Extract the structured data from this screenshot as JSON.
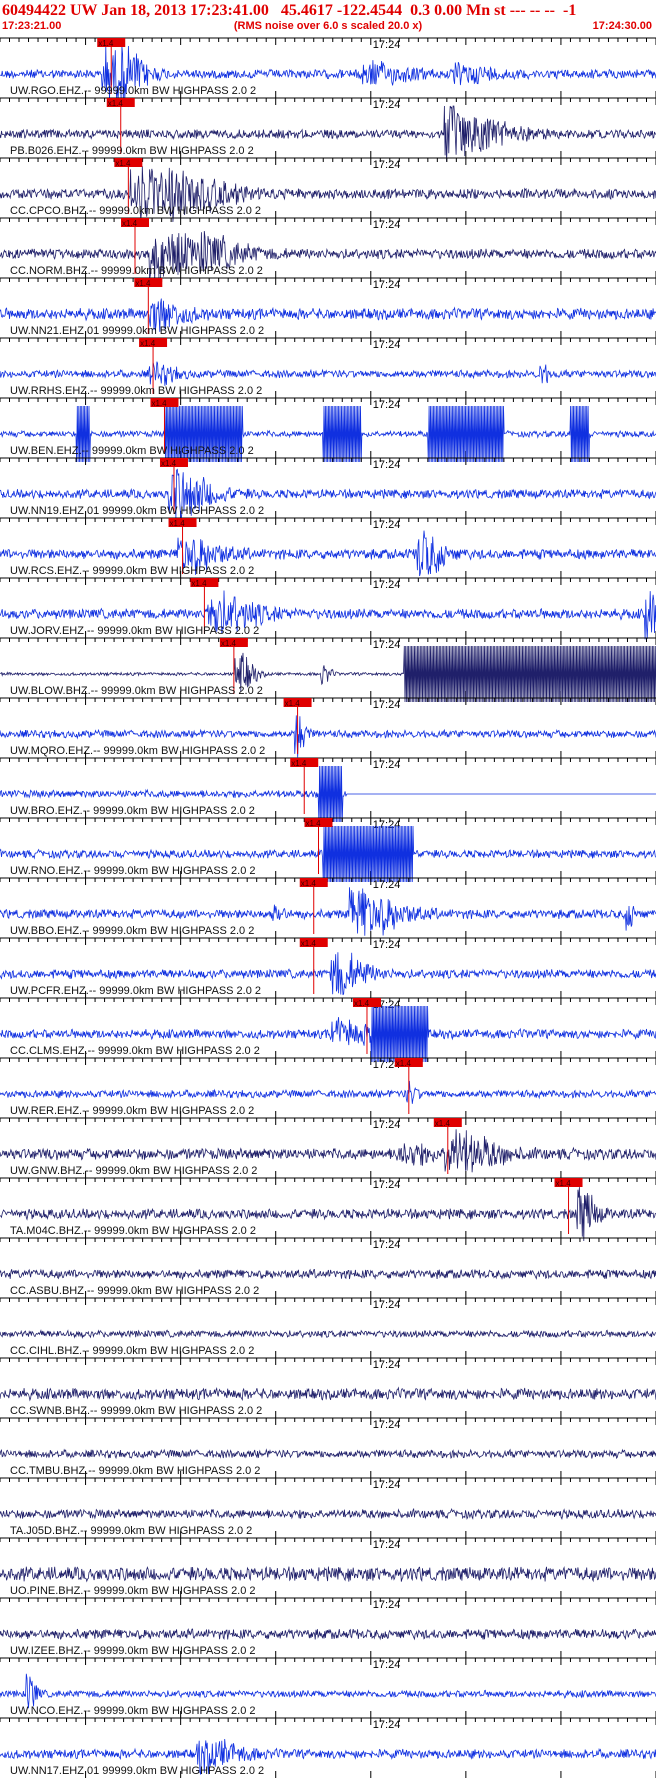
{
  "header": {
    "title": "60494422 UW Jan 18, 2013 17:23:41.00   45.4617 -122.4544  0.3 0.00 Mn st --- -- --  -1",
    "start_time": "17:23:21.00",
    "subtitle": "(RMS noise over 6.0 s scaled 20.0 x)",
    "end_time": "17:24:30.00"
  },
  "colors": {
    "title": "#e00000",
    "trace_blue": "#1030e0",
    "trace_navy": "#20206a",
    "pick_marker": "#e00000",
    "axis": "#000000"
  },
  "chart_data": {
    "type": "line",
    "description_of_axis": "",
    "x_start": "17:23:21.00",
    "x_end": "17:24:30.00",
    "minute_label": "17:24",
    "pick_label": "x1.4",
    "channels": [
      {
        "label": "UW.RGO.EHZ.-- 99999.0km BW  HIGHPASS  2.0  2",
        "color": "blue",
        "pick_s": 11.7,
        "amp": 0.18,
        "events": [
          [
            11,
            1.0,
            4
          ],
          [
            13,
            0.5,
            3
          ],
          [
            38,
            0.4,
            6
          ],
          [
            48,
            0.3,
            5
          ]
        ]
      },
      {
        "label": "PB.B026.EHZ.-- 99999.0km BW  HIGHPASS  2.0  2",
        "color": "navy",
        "pick_s": 12.7,
        "amp": 0.18,
        "events": [
          [
            47,
            1.0,
            7
          ]
        ]
      },
      {
        "label": "CC.CPCO.BHZ.-- 99999.0km BW  HIGHPASS  2.0  2",
        "color": "navy",
        "pick_s": 13.5,
        "amp": 0.2,
        "events": [
          [
            14,
            1.0,
            6
          ],
          [
            18,
            0.6,
            8
          ]
        ]
      },
      {
        "label": "CC.NORM.BHZ.-- 99999.0km BW  HIGHPASS  2.0  2",
        "color": "navy",
        "pick_s": 14.2,
        "amp": 0.2,
        "events": [
          [
            16,
            1.0,
            6
          ],
          [
            21,
            0.5,
            6
          ]
        ]
      },
      {
        "label": "UW.NN21.EHZ.01 99999.0km BW  HIGHPASS  2.0  2",
        "color": "blue",
        "pick_s": 15.6,
        "amp": 0.22,
        "events": [
          [
            16,
            0.6,
            4
          ]
        ]
      },
      {
        "label": "UW.RRHS.EHZ.-- 99999.0km BW  HIGHPASS  2.0  2",
        "color": "blue",
        "pick_s": 16.1,
        "amp": 0.15,
        "events": [
          [
            16,
            0.4,
            3
          ],
          [
            57,
            0.4,
            1
          ]
        ]
      },
      {
        "label": "UW.BEN.EHZ.-- 99999.0km BW  HIGHPASS  2.0  2",
        "color": "blue",
        "pick_s": 17.3,
        "amp": 0.12,
        "clip": [
          [
            8,
            9.5
          ],
          [
            17.3,
            25.5
          ],
          [
            34,
            38
          ],
          [
            45,
            53
          ],
          [
            60,
            62
          ]
        ]
      },
      {
        "label": "UW.NN19.EHZ.01 99999.0km BW  HIGHPASS  2.0  2",
        "color": "blue",
        "pick_s": 18.3,
        "amp": 0.18,
        "events": [
          [
            18,
            1.0,
            5
          ]
        ]
      },
      {
        "label": "UW.RCS.EHZ.-- 99999.0km BW  HIGHPASS  2.0  2",
        "color": "blue",
        "pick_s": 19.2,
        "amp": 0.2,
        "events": [
          [
            19,
            0.7,
            5
          ],
          [
            44,
            1.0,
            3
          ]
        ]
      },
      {
        "label": "UW.JORV.EHZ.-- 99999.0km BW  HIGHPASS  2.0  2",
        "color": "blue",
        "pick_s": 21.5,
        "amp": 0.2,
        "events": [
          [
            22,
            0.8,
            6
          ],
          [
            68,
            1.0,
            2
          ]
        ]
      },
      {
        "label": "UW.BLOW.BHZ.-- 99999.0km BW  HIGHPASS  2.0  2",
        "color": "navy",
        "pick_s": 24.6,
        "amp": 0.06,
        "events": [
          [
            25,
            0.9,
            2
          ],
          [
            34,
            0.4,
            1
          ]
        ],
        "clip": [
          [
            42.5,
            69
          ]
        ]
      },
      {
        "label": "UW.MQRO.EHZ.-- 99999.0km BW  HIGHPASS  2.0  2",
        "color": "blue",
        "pick_s": 31.3,
        "amp": 0.15,
        "events": [
          [
            31.3,
            1.0,
            1
          ]
        ]
      },
      {
        "label": "UW.BRO.EHZ.-- 99999.0km BW  HIGHPASS  2.0  2",
        "color": "blue",
        "pick_s": 32.0,
        "amp": 0.15,
        "clip": [
          [
            33.5,
            36
          ]
        ],
        "flat": [
          [
            36.5,
            69
          ]
        ],
        "events": [
          [
            52,
            0.8,
            1
          ]
        ]
      },
      {
        "label": "UW.RNO.EHZ.-- 99999.0km BW  HIGHPASS  2.0  2",
        "color": "blue",
        "pick_s": 33.5,
        "amp": 0.16,
        "clip": [
          [
            34,
            43.5
          ]
        ]
      },
      {
        "label": "UW.BBO.EHZ.-- 99999.0km BW  HIGHPASS  2.0  2",
        "color": "blue",
        "pick_s": 33.0,
        "amp": 0.18,
        "events": [
          [
            37,
            1.0,
            6
          ],
          [
            29,
            0.4,
            1
          ],
          [
            66,
            0.5,
            1
          ]
        ]
      },
      {
        "label": "UW.PCFR.EHZ.-- 99999.0km BW  HIGHPASS  2.0  2",
        "color": "blue",
        "pick_s": 33.0,
        "amp": 0.18,
        "events": [
          [
            35,
            0.9,
            4
          ]
        ]
      },
      {
        "label": "CC.CLMS.EHZ.-- 99999.0km BW  HIGHPASS  2.0  2",
        "color": "blue",
        "pick_s": 38.6,
        "amp": 0.18,
        "events": [
          [
            35,
            0.5,
            5
          ]
        ],
        "clip": [
          [
            39,
            45
          ]
        ]
      },
      {
        "label": "UW.RER.EHZ.-- 99999.0km BW  HIGHPASS  2.0  2",
        "color": "blue",
        "pick_s": 43.0,
        "amp": 0.15,
        "events": [
          [
            43,
            0.4,
            1
          ]
        ]
      },
      {
        "label": "UW.GNW.BHZ.-- 99999.0km BW  HIGHPASS  2.0  2",
        "color": "navy",
        "pick_s": 47.1,
        "amp": 0.22,
        "events": [
          [
            47,
            0.9,
            6
          ],
          [
            42,
            0.4,
            4
          ]
        ]
      },
      {
        "label": "TA.M04C.BHZ.-- 99999.0km BW  HIGHPASS  2.0  2",
        "color": "navy",
        "pick_s": 59.8,
        "amp": 0.2,
        "events": [
          [
            61,
            1.0,
            2
          ]
        ]
      },
      {
        "label": "CC.ASBU.BHZ.-- 99999.0km BW  HIGHPASS  2.0  2",
        "color": "navy",
        "amp": 0.18
      },
      {
        "label": "CC.CIHL.BHZ.-- 99999.0km BW  HIGHPASS  2.0  2",
        "color": "navy",
        "amp": 0.14
      },
      {
        "label": "CC.SWNB.BHZ.-- 99999.0km BW  HIGHPASS  2.0  2",
        "color": "navy",
        "amp": 0.22
      },
      {
        "label": "CC.TMBU.BHZ.-- 99999.0km BW  HIGHPASS  2.0  2",
        "color": "navy",
        "amp": 0.16
      },
      {
        "label": "TA.J05D.BHZ.-- 99999.0km BW  HIGHPASS  2.0  2",
        "color": "navy",
        "amp": 0.18
      },
      {
        "label": "UO.PINE.BHZ.-- 99999.0km BW  HIGHPASS  2.0  2",
        "color": "navy",
        "amp": 0.28
      },
      {
        "label": "UW.IZEE.BHZ.-- 99999.0km BW  HIGHPASS  2.0  2",
        "color": "navy",
        "amp": 0.2
      },
      {
        "label": "UW.NCO.EHZ.-- 99999.0km BW  HIGHPASS  2.0  2",
        "color": "blue",
        "amp": 0.14,
        "events": [
          [
            3,
            0.8,
            1
          ]
        ]
      },
      {
        "label": "UW.NN17.EHZ.01 99999.0km BW  HIGHPASS  2.0  2",
        "color": "blue",
        "amp": 0.18,
        "events": [
          [
            21,
            0.6,
            5
          ]
        ]
      }
    ]
  }
}
